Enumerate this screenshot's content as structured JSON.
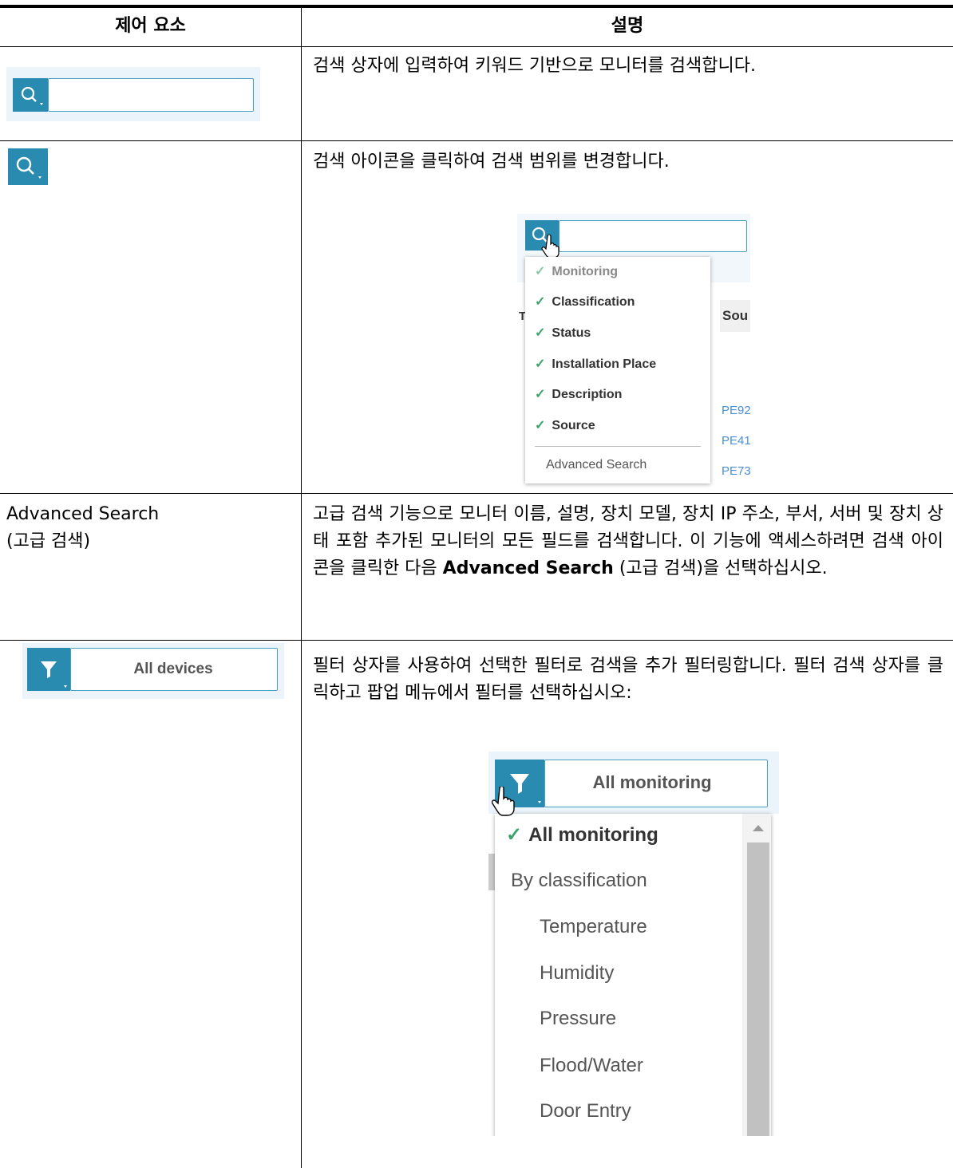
{
  "header": {
    "col1": "제어 요소",
    "col2": "설명"
  },
  "row1": {
    "description": "검색 상자에 입력하여 키워드 기반으로 모니터를 검색합니다."
  },
  "row2": {
    "description": "검색 아이콘을 클릭하여 검색 범위를 변경합니다.",
    "menu_items": [
      "Monitoring",
      "Classification",
      "Status",
      "Installation Place",
      "Description",
      "Source"
    ],
    "menu_advanced": "Advanced Search",
    "bg_header_t": "T",
    "bg_header_source": "Sou",
    "bg_links": [
      "PE92",
      "PE41",
      "PE73"
    ]
  },
  "row3": {
    "control_line1": "Advanced Search",
    "control_line2": "(고급 검색)",
    "description_part1": "고급 검색 기능으로 모니터 이름, 설명, 장치 모델, 장치 IP 주소, 부서, 서버 및 장치 상태 포함 추가된 모니터의 모든 필드를 검색합니다. 이 기능에 액세스하려면 검색 아이콘을 클릭한 다음 ",
    "description_bold": "Advanced Search",
    "description_part2": " (고급 검색)을 선택하십시오."
  },
  "row4": {
    "filter_label": "All devices",
    "description": "필터 상자를 사용하여 선택한 필터로 검색을 추가 필터링합니다. 필터 검색 상자를 클릭하고 팝업 메뉴에서 필터를 선택하십시오:",
    "dropdown_label": "All monitoring",
    "dropdown_selected": "All monitoring",
    "dropdown_group": "By classification",
    "dropdown_items": [
      "Temperature",
      "Humidity",
      "Pressure",
      "Flood/Water",
      "Door Entry"
    ]
  },
  "colors": {
    "accent": "#2a8bb0",
    "check": "#3aa56a",
    "link": "#4b8fd6"
  },
  "icons": [
    "search-icon",
    "filter-icon",
    "check-icon",
    "hand-cursor-icon",
    "scroll-up-icon"
  ]
}
